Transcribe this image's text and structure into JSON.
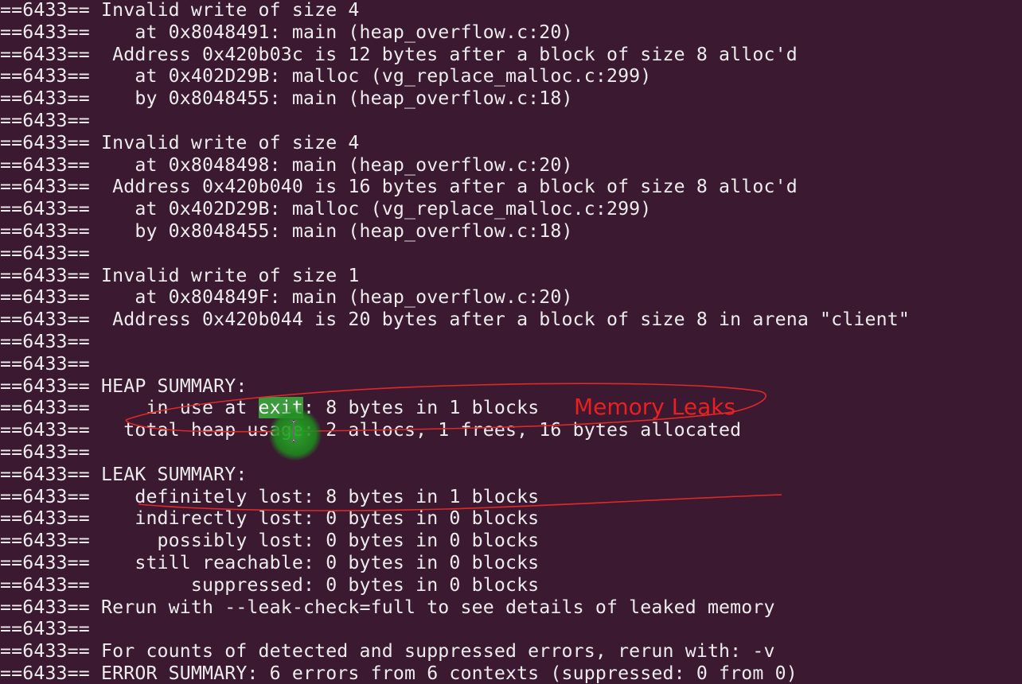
{
  "terminal": {
    "background": "#3b1931",
    "text_color": "#ececec",
    "selection_color": "#3b9a3b",
    "lines": [
      {
        "prefix": "==6433==",
        "text": " Invalid write of size 4"
      },
      {
        "prefix": "==6433==",
        "text": "    at 0x8048491: main (heap_overflow.c:20)"
      },
      {
        "prefix": "==6433==",
        "text": "  Address 0x420b03c is 12 bytes after a block of size 8 alloc'd"
      },
      {
        "prefix": "==6433==",
        "text": "    at 0x402D29B: malloc (vg_replace_malloc.c:299)"
      },
      {
        "prefix": "==6433==",
        "text": "    by 0x8048455: main (heap_overflow.c:18)"
      },
      {
        "prefix": "==6433==",
        "text": ""
      },
      {
        "prefix": "==6433==",
        "text": " Invalid write of size 4"
      },
      {
        "prefix": "==6433==",
        "text": "    at 0x8048498: main (heap_overflow.c:20)"
      },
      {
        "prefix": "==6433==",
        "text": "  Address 0x420b040 is 16 bytes after a block of size 8 alloc'd"
      },
      {
        "prefix": "==6433==",
        "text": "    at 0x402D29B: malloc (vg_replace_malloc.c:299)"
      },
      {
        "prefix": "==6433==",
        "text": "    by 0x8048455: main (heap_overflow.c:18)"
      },
      {
        "prefix": "==6433==",
        "text": ""
      },
      {
        "prefix": "==6433==",
        "text": " Invalid write of size 1"
      },
      {
        "prefix": "==6433==",
        "text": "    at 0x804849F: main (heap_overflow.c:20)"
      },
      {
        "prefix": "==6433==",
        "text": "  Address 0x420b044 is 20 bytes after a block of size 8 in arena \"client\""
      },
      {
        "prefix": "==6433==",
        "text": ""
      },
      {
        "prefix": "==6433==",
        "text": ""
      },
      {
        "prefix": "==6433==",
        "text": " HEAP SUMMARY:"
      },
      {
        "prefix": "==6433==",
        "before": "     in use at ",
        "selected": "exit",
        "after": ": 8 bytes in 1 blocks"
      },
      {
        "prefix": "==6433==",
        "text": "   total heap usage: 2 allocs, 1 frees, 16 bytes allocated"
      },
      {
        "prefix": "==6433==",
        "text": ""
      },
      {
        "prefix": "==6433==",
        "text": " LEAK SUMMARY:"
      },
      {
        "prefix": "==6433==",
        "text": "    definitely lost: 8 bytes in 1 blocks"
      },
      {
        "prefix": "==6433==",
        "text": "    indirectly lost: 0 bytes in 0 blocks"
      },
      {
        "prefix": "==6433==",
        "text": "      possibly lost: 0 bytes in 0 blocks"
      },
      {
        "prefix": "==6433==",
        "text": "    still reachable: 0 bytes in 0 blocks"
      },
      {
        "prefix": "==6433==",
        "text": "         suppressed: 0 bytes in 0 blocks"
      },
      {
        "prefix": "==6433==",
        "text": " Rerun with --leak-check=full to see details of leaked memory"
      },
      {
        "prefix": "==6433==",
        "text": ""
      },
      {
        "prefix": "==6433==",
        "text": " For counts of detected and suppressed errors, rerun with: -v"
      },
      {
        "prefix": "==6433==",
        "text": " ERROR SUMMARY: 6 errors from 6 contexts (suppressed: 0 from 0)"
      }
    ]
  },
  "annotation": {
    "label": "Memory Leaks",
    "color": "#e82020"
  },
  "cursor": {
    "icon": "i-beam-cursor-icon",
    "highlight_color": "#2e9e2e"
  }
}
